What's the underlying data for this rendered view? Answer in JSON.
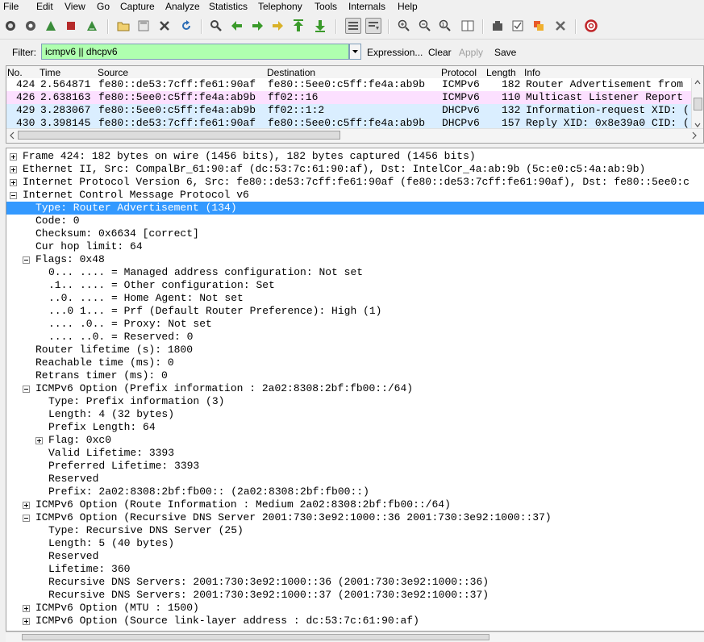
{
  "menu": [
    "File",
    "Edit",
    "View",
    "Go",
    "Capture",
    "Analyze",
    "Statistics",
    "Telephony",
    "Tools",
    "Internals",
    "Help"
  ],
  "filter": {
    "label": "Filter:",
    "value": "icmpv6 || dhcpv6",
    "expression": "Expression...",
    "clear": "Clear",
    "apply": "Apply",
    "save": "Save",
    "bg_color": "#afffaf"
  },
  "packet_list": {
    "columns": [
      "No.",
      "Time",
      "Source",
      "Destination",
      "Protocol",
      "Length",
      "Info"
    ],
    "rows": [
      {
        "no": "424",
        "time": "2.564871",
        "src": "fe80::de53:7cff:fe61:90af",
        "dst": "fe80::5ee0:c5ff:fe4a:ab9b",
        "proto": "ICMPv6",
        "len": "182",
        "info": "Router Advertisement from",
        "bg": "#fff"
      },
      {
        "no": "426",
        "time": "2.638163",
        "src": "fe80::5ee0:c5ff:fe4a:ab9b",
        "dst": "ff02::16",
        "proto": "ICMPv6",
        "len": "110",
        "info": "Multicast Listener Report",
        "bg": "#fce0ff"
      },
      {
        "no": "429",
        "time": "3.283067",
        "src": "fe80::5ee0:c5ff:fe4a:ab9b",
        "dst": "ff02::1:2",
        "proto": "DHCPv6",
        "len": "132",
        "info": "Information-request XID: (",
        "bg": "#daeeff"
      },
      {
        "no": "430",
        "time": "3.398145",
        "src": "fe80::de53:7cff:fe61:90af",
        "dst": "fe80::5ee0:c5ff:fe4a:ab9b",
        "proto": "DHCPv6",
        "len": "157",
        "info": "Reply XID: 0x8e39a0 CID: (",
        "bg": "#daeeff"
      }
    ]
  },
  "details": [
    {
      "indent": 0,
      "exp": "plus",
      "text": "Frame 424: 182 bytes on wire (1456 bits), 182 bytes captured (1456 bits)"
    },
    {
      "indent": 0,
      "exp": "plus",
      "text": "Ethernet II, Src: CompalBr_61:90:af (dc:53:7c:61:90:af), Dst: IntelCor_4a:ab:9b (5c:e0:c5:4a:ab:9b)"
    },
    {
      "indent": 0,
      "exp": "plus",
      "text": "Internet Protocol Version 6, Src: fe80::de53:7cff:fe61:90af (fe80::de53:7cff:fe61:90af), Dst: fe80::5ee0:c"
    },
    {
      "indent": 0,
      "exp": "minus",
      "text": "Internet Control Message Protocol v6"
    },
    {
      "indent": 1,
      "exp": "",
      "text": "Type: Router Advertisement (134)",
      "selected": true
    },
    {
      "indent": 1,
      "exp": "",
      "text": "Code: 0"
    },
    {
      "indent": 1,
      "exp": "",
      "text": "Checksum: 0x6634 [correct]"
    },
    {
      "indent": 1,
      "exp": "",
      "text": "Cur hop limit: 64"
    },
    {
      "indent": 1,
      "exp": "minus",
      "text": "Flags: 0x48"
    },
    {
      "indent": 2,
      "exp": "",
      "text": "0... .... = Managed address configuration: Not set"
    },
    {
      "indent": 2,
      "exp": "",
      "text": ".1.. .... = Other configuration: Set"
    },
    {
      "indent": 2,
      "exp": "",
      "text": "..0. .... = Home Agent: Not set"
    },
    {
      "indent": 2,
      "exp": "",
      "text": "...0 1... = Prf (Default Router Preference): High (1)"
    },
    {
      "indent": 2,
      "exp": "",
      "text": ".... .0.. = Proxy: Not set"
    },
    {
      "indent": 2,
      "exp": "",
      "text": ".... ..0. = Reserved: 0"
    },
    {
      "indent": 1,
      "exp": "",
      "text": "Router lifetime (s): 1800"
    },
    {
      "indent": 1,
      "exp": "",
      "text": "Reachable time (ms): 0"
    },
    {
      "indent": 1,
      "exp": "",
      "text": "Retrans timer (ms): 0"
    },
    {
      "indent": 1,
      "exp": "minus",
      "text": "ICMPv6 Option (Prefix information : 2a02:8308:2bf:fb00::/64)"
    },
    {
      "indent": 2,
      "exp": "",
      "text": "Type: Prefix information (3)"
    },
    {
      "indent": 2,
      "exp": "",
      "text": "Length: 4 (32 bytes)"
    },
    {
      "indent": 2,
      "exp": "",
      "text": "Prefix Length: 64"
    },
    {
      "indent": 2,
      "exp": "plus",
      "text": "Flag: 0xc0"
    },
    {
      "indent": 2,
      "exp": "",
      "text": "Valid Lifetime: 3393"
    },
    {
      "indent": 2,
      "exp": "",
      "text": "Preferred Lifetime: 3393"
    },
    {
      "indent": 2,
      "exp": "",
      "text": "Reserved"
    },
    {
      "indent": 2,
      "exp": "",
      "text": "Prefix: 2a02:8308:2bf:fb00:: (2a02:8308:2bf:fb00::)"
    },
    {
      "indent": 1,
      "exp": "plus",
      "text": "ICMPv6 Option (Route Information : Medium 2a02:8308:2bf:fb00::/64)"
    },
    {
      "indent": 1,
      "exp": "minus",
      "text": "ICMPv6 Option (Recursive DNS Server 2001:730:3e92:1000::36 2001:730:3e92:1000::37)"
    },
    {
      "indent": 2,
      "exp": "",
      "text": "Type: Recursive DNS Server (25)"
    },
    {
      "indent": 2,
      "exp": "",
      "text": "Length: 5 (40 bytes)"
    },
    {
      "indent": 2,
      "exp": "",
      "text": "Reserved"
    },
    {
      "indent": 2,
      "exp": "",
      "text": "Lifetime: 360"
    },
    {
      "indent": 2,
      "exp": "",
      "text": "Recursive DNS Servers: 2001:730:3e92:1000::36 (2001:730:3e92:1000::36)"
    },
    {
      "indent": 2,
      "exp": "",
      "text": "Recursive DNS Servers: 2001:730:3e92:1000::37 (2001:730:3e92:1000::37)"
    },
    {
      "indent": 1,
      "exp": "plus",
      "text": "ICMPv6 Option (MTU : 1500)"
    },
    {
      "indent": 1,
      "exp": "plus",
      "text": "ICMPv6 Option (Source link-layer address : dc:53:7c:61:90:af)"
    }
  ],
  "colors": {
    "selected": "#3399ff",
    "filter_ok": "#afffaf"
  },
  "toolbar_icons": [
    "interface-list-icon",
    "capture-options-icon",
    "start-capture-icon",
    "stop-capture-icon",
    "restart-capture-icon",
    "open-file-icon",
    "save-file-icon",
    "close-file-icon",
    "reload-icon",
    "find-icon",
    "go-back-icon",
    "go-forward-icon",
    "go-to-packet-icon",
    "go-first-icon",
    "go-last-icon",
    "colorize-icon",
    "auto-scroll-icon",
    "zoom-in-icon",
    "zoom-out-icon",
    "normal-size-icon",
    "resize-columns-icon",
    "capture-filters-icon",
    "display-filters-icon",
    "coloring-rules-icon",
    "preferences-icon",
    "help-icon"
  ]
}
